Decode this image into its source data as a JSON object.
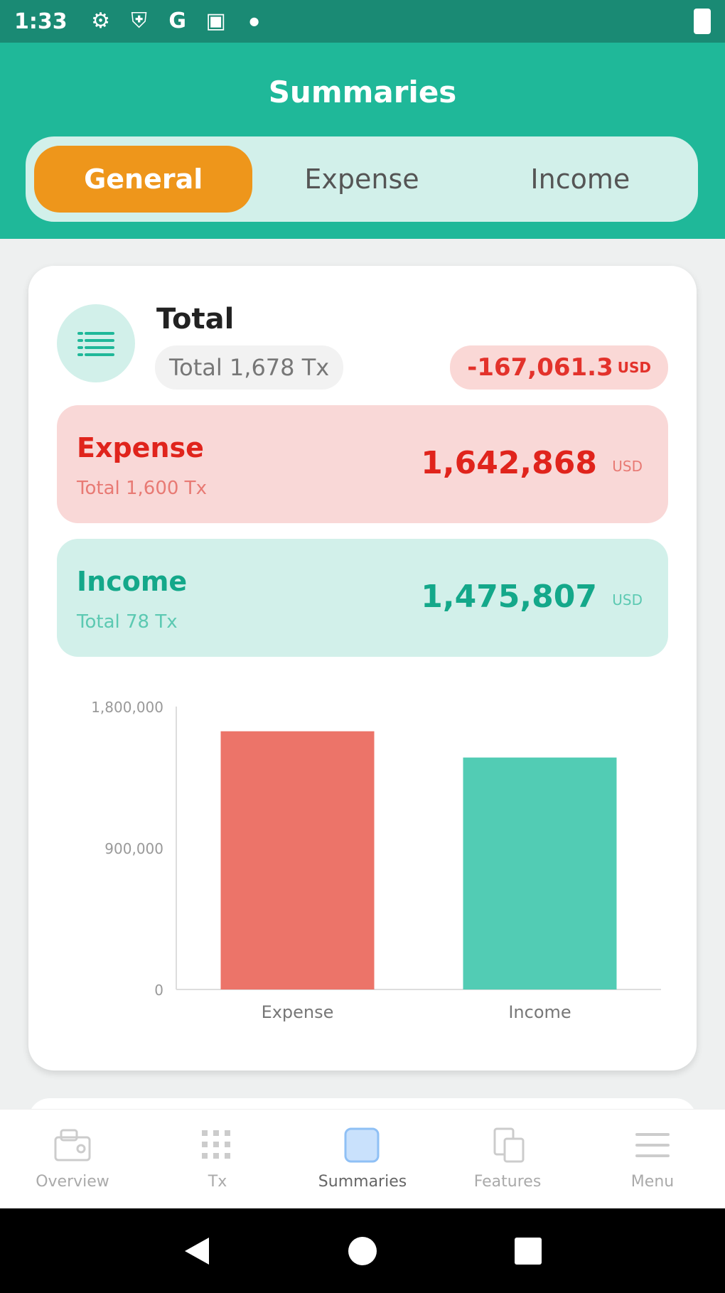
{
  "status_bar": {
    "time": "1:33"
  },
  "header": {
    "title": "Summaries"
  },
  "tabs": [
    {
      "label": "General",
      "active": true
    },
    {
      "label": "Expense",
      "active": false
    },
    {
      "label": "Income",
      "active": false
    }
  ],
  "total": {
    "title": "Total",
    "tx_count": "Total 1,678 Tx",
    "net_amount": "-167,061.3",
    "net_unit": "USD"
  },
  "expense": {
    "label": "Expense",
    "tx_count": "Total 1,600 Tx",
    "amount": "1,642,868",
    "unit": "USD"
  },
  "income": {
    "label": "Income",
    "tx_count": "Total 78 Tx",
    "amount": "1,475,807",
    "unit": "USD"
  },
  "chart_data": {
    "type": "bar",
    "categories": [
      "Expense",
      "Income"
    ],
    "values": [
      1642868,
      1475807
    ],
    "ylim": [
      0,
      1800000
    ],
    "yticks": [
      "0",
      "900,000",
      "1,800,000"
    ],
    "colors": [
      "#ec7469",
      "#52ccb4"
    ]
  },
  "bottom_nav": [
    {
      "label": "Overview",
      "icon": "overview-icon",
      "active": false
    },
    {
      "label": "Tx",
      "icon": "transactions-icon",
      "active": false
    },
    {
      "label": "Summaries",
      "icon": "summaries-icon",
      "active": true
    },
    {
      "label": "Features",
      "icon": "features-icon",
      "active": false
    },
    {
      "label": "Menu",
      "icon": "menu-icon",
      "active": false
    }
  ],
  "colors": {
    "header": "#1fb899",
    "accent": "#ee961b",
    "expense": "#e0241c",
    "income": "#14a88a"
  }
}
